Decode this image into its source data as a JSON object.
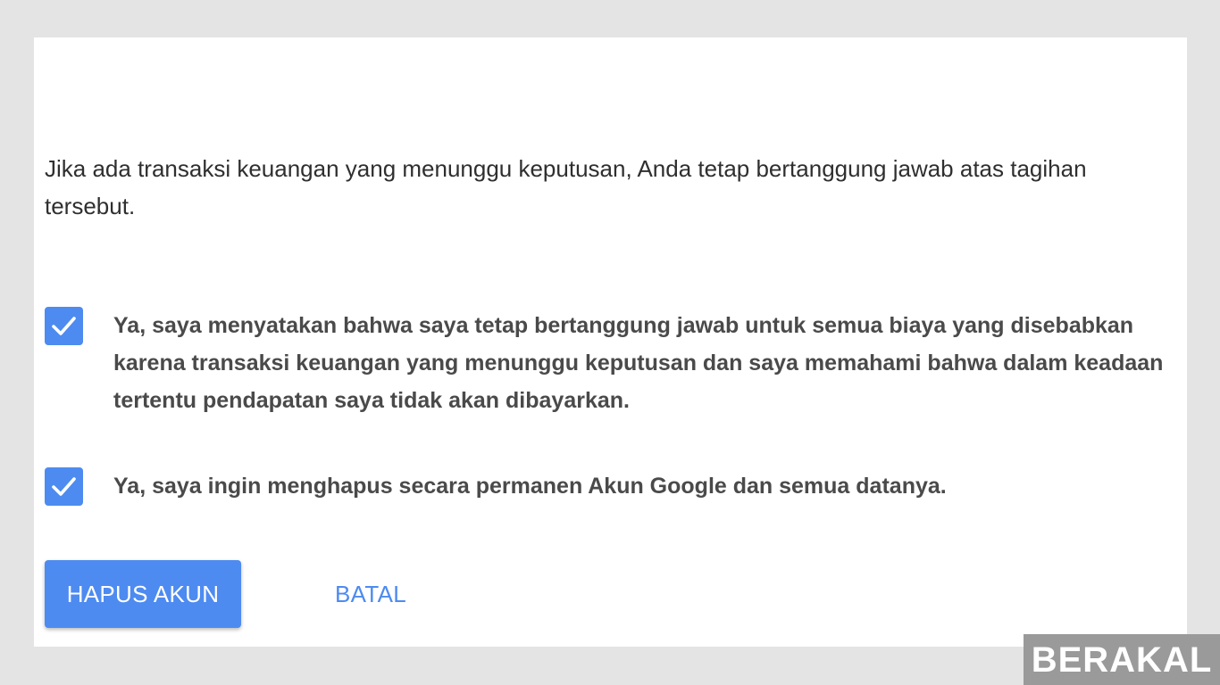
{
  "dialog": {
    "intro_text": "Jika ada transaksi keuangan yang menunggu keputusan, Anda tetap bertanggung jawab atas tagihan tersebut.",
    "checkboxes": [
      {
        "checked": true,
        "label": "Ya, saya menyatakan bahwa saya tetap bertanggung jawab untuk semua biaya yang disebabkan karena transaksi keuangan yang menunggu keputusan dan saya memahami bahwa dalam keadaan tertentu pendapatan saya tidak akan dibayarkan."
      },
      {
        "checked": true,
        "label": "Ya, saya ingin menghapus secara permanen Akun Google dan semua datanya."
      }
    ],
    "primary_button_label": "HAPUS AKUN",
    "secondary_button_label": "BATAL"
  },
  "watermark": {
    "text": "BERAKAL"
  },
  "colors": {
    "accent": "#4d8bf0",
    "background": "#e4e4e4",
    "card": "#ffffff",
    "watermark_bg": "#9a9a9a"
  },
  "icons": {
    "checkbox_mark": "check-icon"
  }
}
